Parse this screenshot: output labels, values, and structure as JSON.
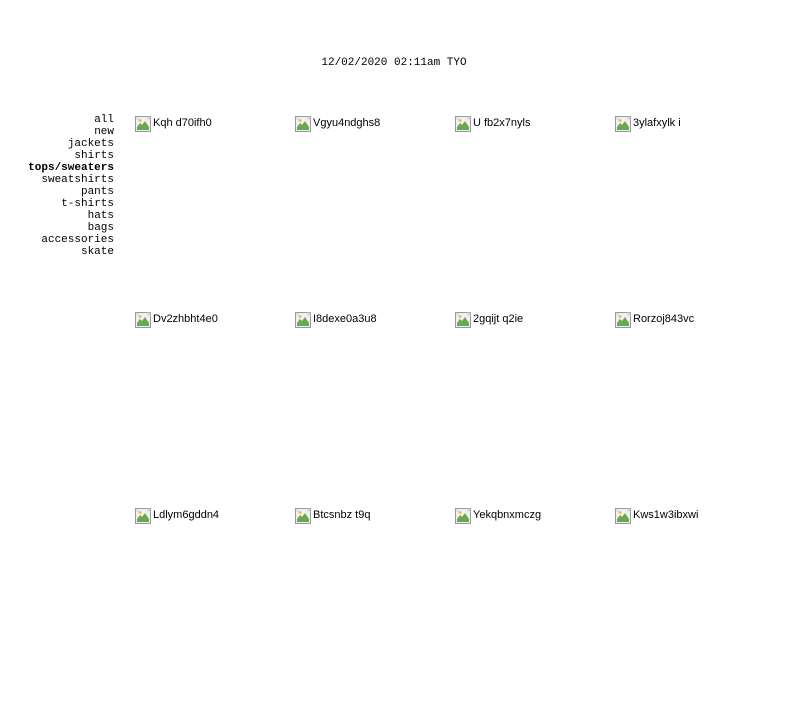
{
  "header": {
    "datetime": "12/02/2020 02:11am TYO"
  },
  "sidebar": {
    "categories": [
      {
        "label": "all",
        "active": false
      },
      {
        "label": "new",
        "active": false
      },
      {
        "label": "jackets",
        "active": false
      },
      {
        "label": "shirts",
        "active": false
      },
      {
        "label": "tops/sweaters",
        "active": true
      },
      {
        "label": "sweatshirts",
        "active": false
      },
      {
        "label": "pants",
        "active": false
      },
      {
        "label": "t-shirts",
        "active": false
      },
      {
        "label": "hats",
        "active": false
      },
      {
        "label": "bags",
        "active": false
      },
      {
        "label": "accessories",
        "active": false
      },
      {
        "label": "skate",
        "active": false
      }
    ]
  },
  "products": [
    {
      "alt": "Kqh d70ifh0"
    },
    {
      "alt": "Vgyu4ndghs8"
    },
    {
      "alt": "U fb2x7nyls"
    },
    {
      "alt": "3ylafxylk i"
    },
    {
      "alt": "Dv2zhbht4e0"
    },
    {
      "alt": "I8dexe0a3u8"
    },
    {
      "alt": "2gqijt q2ie"
    },
    {
      "alt": "Rorzoj843vc"
    },
    {
      "alt": "Ldlym6gddn4"
    },
    {
      "alt": "Btcsnbz t9q"
    },
    {
      "alt": "Yekqbnxmczg"
    },
    {
      "alt": "Kws1w3ibxwi"
    }
  ]
}
